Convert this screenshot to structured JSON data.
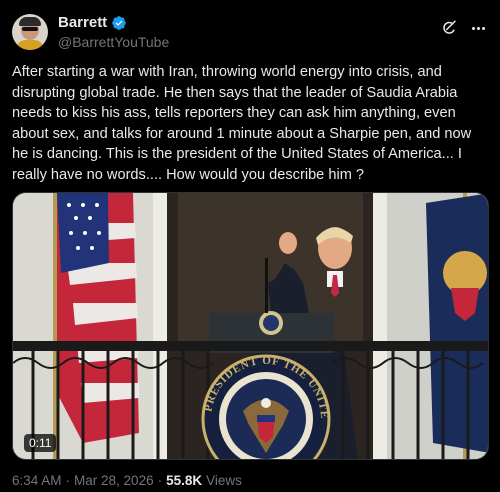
{
  "author": {
    "display_name": "Barrett",
    "handle": "@BarrettYouTube",
    "verified": true
  },
  "tweet": {
    "text": "After starting a war with Iran, throwing world energy into crisis, and disrupting global trade. He then says that the leader of Saudia Arabia needs to kiss his ass, tells reporters they can ask him anything, even about sex, and talks for around 1 minute about a Sharpie pen, and now he is dancing. This is the president of the United States of America... I really have no words.... How would you describe him ?"
  },
  "media": {
    "type": "video",
    "duration": "0:11",
    "seal_text": "PRESIDENT OF THE UNITED"
  },
  "meta": {
    "time": "6:34 AM",
    "separator1": "·",
    "date": "Mar 28, 2026",
    "separator2": "·",
    "views_count": "55.8K",
    "views_label": "Views"
  },
  "colors": {
    "verified_blue": "#1d9bf0",
    "secondary_text": "#71767b",
    "background": "#000000"
  },
  "icons": [
    "verified-badge-icon",
    "grok-icon",
    "more-options-icon"
  ]
}
